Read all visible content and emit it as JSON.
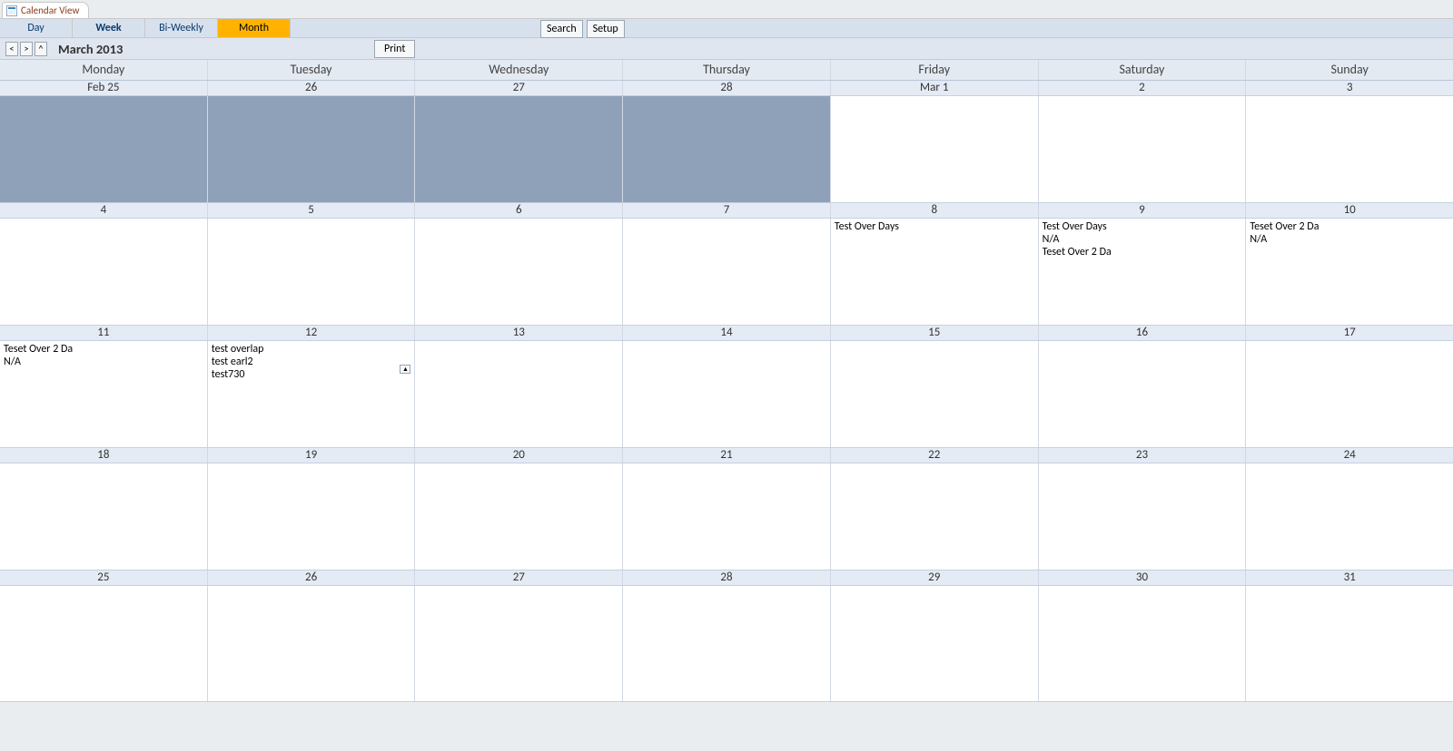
{
  "doc_tab": {
    "label": "Calendar View"
  },
  "view_tabs": [
    "Day",
    "Week",
    "Bi-Weekly",
    "Month"
  ],
  "active_view_index": 3,
  "buttons": {
    "search": "Search",
    "setup": "Setup",
    "print": "Print"
  },
  "nav": {
    "prev": "<",
    "next": ">",
    "today": "^"
  },
  "title": "March 2013",
  "weekdays": [
    "Monday",
    "Tuesday",
    "Wednesday",
    "Thursday",
    "Friday",
    "Saturday",
    "Sunday"
  ],
  "weeks": [
    {
      "dates": [
        "Feb 25",
        "26",
        "27",
        "28",
        "Mar 1",
        "2",
        "3"
      ],
      "flags": [
        "prev",
        "prev",
        "prev",
        "prev",
        "",
        "",
        ""
      ],
      "events": [
        [],
        [],
        [],
        [],
        [],
        [],
        []
      ]
    },
    {
      "dates": [
        "4",
        "5",
        "6",
        "7",
        "8",
        "9",
        "10"
      ],
      "flags": [
        "",
        "",
        "",
        "",
        "",
        "",
        ""
      ],
      "events": [
        [],
        [],
        [],
        [],
        [
          "Test Over Days"
        ],
        [
          "Test Over Days",
          "N/A",
          "Teset Over 2 Da"
        ],
        [
          "Teset Over 2 Da",
          "N/A"
        ]
      ]
    },
    {
      "dates": [
        "11",
        "12",
        "13",
        "14",
        "15",
        "16",
        "17"
      ],
      "flags": [
        "",
        "",
        "",
        "",
        "",
        "",
        ""
      ],
      "events": [
        [
          "Teset Over 2 Da",
          "N/A"
        ],
        [
          "test overlap",
          "test earl2",
          "test730"
        ],
        [],
        [],
        [],
        [],
        []
      ],
      "more_indicator_col": 1
    },
    {
      "dates": [
        "18",
        "19",
        "20",
        "21",
        "22",
        "23",
        "24"
      ],
      "flags": [
        "",
        "",
        "",
        "",
        "",
        "",
        ""
      ],
      "events": [
        [],
        [],
        [],
        [],
        [],
        [],
        []
      ]
    },
    {
      "dates": [
        "25",
        "26",
        "27",
        "28",
        "29",
        "30",
        "31"
      ],
      "flags": [
        "",
        "",
        "",
        "",
        "",
        "",
        ""
      ],
      "events": [
        [],
        [],
        [],
        [],
        [],
        [],
        []
      ]
    }
  ]
}
